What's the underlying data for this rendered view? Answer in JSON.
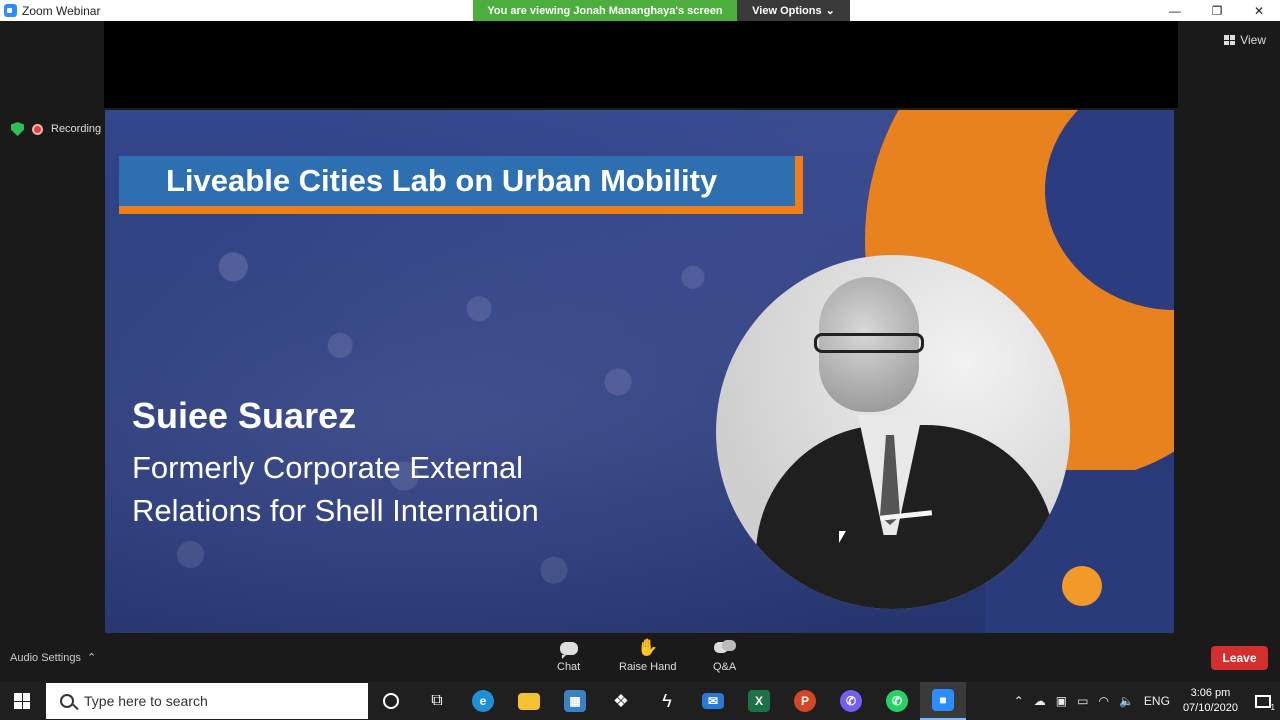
{
  "window": {
    "app_title": "Zoom Webinar",
    "viewing_banner": "You are viewing Jonah Mananghaya's screen",
    "view_options_label": "View Options"
  },
  "main": {
    "view_label": "View",
    "recording_label": "Recording"
  },
  "slide": {
    "title": "Liveable Cities Lab on Urban Mobility",
    "speaker_name": "Suiee Suarez",
    "speaker_role_line1": "Formerly Corporate External",
    "speaker_role_line2": "Relations for Shell Internation"
  },
  "toolbar": {
    "audio_settings_label": "Audio Settings",
    "chat_label": "Chat",
    "raise_hand_label": "Raise Hand",
    "qa_label": "Q&A",
    "leave_label": "Leave"
  },
  "taskbar": {
    "search_placeholder": "Type here to search",
    "language": "ENG",
    "time": "3:06 pm",
    "date": "07/10/2020",
    "notification_count": "1"
  },
  "colors": {
    "banner_green": "#4caf3d",
    "leave_red": "#d32f2f",
    "slide_orange": "#ef7d18",
    "slide_blue": "#2d6fb0"
  }
}
